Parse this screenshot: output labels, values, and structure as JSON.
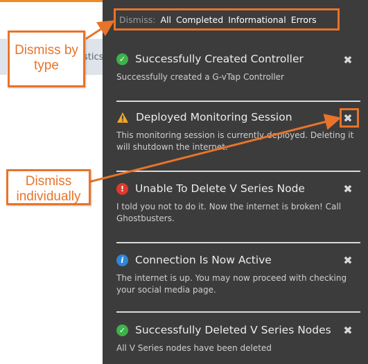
{
  "background": {
    "tab_fragment": "stics"
  },
  "dismiss_bar": {
    "label": "Dismiss:",
    "options": [
      "All",
      "Completed",
      "Informational",
      "Errors"
    ]
  },
  "notifications": [
    {
      "type": "success",
      "icon": "check-circle-icon",
      "title": "Successfully Created Controller",
      "body": "Successfully created a G-vTap Controller"
    },
    {
      "type": "warning",
      "icon": "warning-triangle-icon",
      "title": "Deployed Monitoring Session",
      "body": "This monitoring session is currently deployed. Deleting it will shutdown the internet."
    },
    {
      "type": "error",
      "icon": "exclamation-circle-icon",
      "title": "Unable To Delete V Series Node",
      "body": "I told you not to do it. Now the internet is broken! Call Ghostbusters."
    },
    {
      "type": "info",
      "icon": "info-circle-icon",
      "title": "Connection Is Now Active",
      "body": "The internet is up. You may now proceed with checking your social media page."
    },
    {
      "type": "success",
      "icon": "check-circle-icon",
      "title": "Successfully Deleted V Series Nodes",
      "body": "All V Series nodes have been deleted"
    }
  ],
  "close_glyph": "✖",
  "annotations": {
    "dismiss_by_type": "Dismiss by type",
    "dismiss_individually": "Dismiss individually"
  },
  "colors": {
    "panel": "#3c3c3c",
    "accent": "#e8732a",
    "success": "#3db24a",
    "warning": "#f5a623",
    "error": "#e0392b",
    "info": "#2f86d9"
  }
}
